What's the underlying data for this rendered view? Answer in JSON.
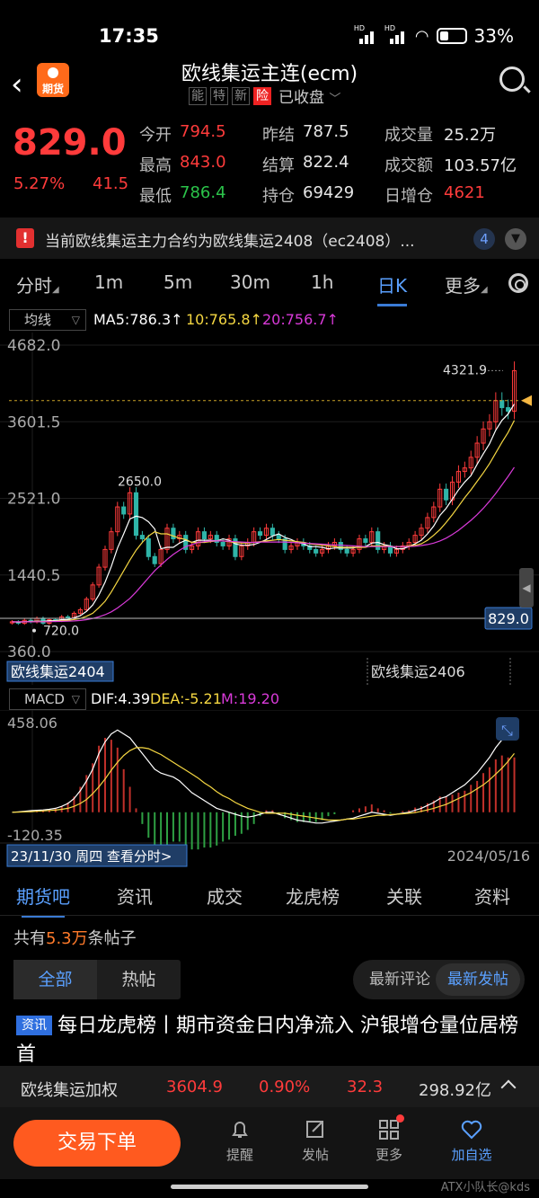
{
  "status": {
    "time": "17:35",
    "hd1": "HD",
    "hd2": "HD",
    "battery": "33%"
  },
  "header": {
    "logo_text": "期货",
    "title": "欧线集运主连(ecm)",
    "tags": [
      "能",
      "特",
      "新",
      "险"
    ],
    "state": "已收盘"
  },
  "quote": {
    "price": "829.0",
    "pct": "5.27%",
    "change": "41.5",
    "fields": [
      {
        "k": "今开",
        "v": "794.5",
        "color": "red"
      },
      {
        "k": "昨结",
        "v": "787.5",
        "color": "white"
      },
      {
        "k": "成交量",
        "v": "25.2万",
        "color": "white"
      },
      {
        "k": "最高",
        "v": "843.0",
        "color": "red"
      },
      {
        "k": "结算",
        "v": "822.4",
        "color": "white"
      },
      {
        "k": "成交额",
        "v": "103.57亿",
        "color": "white"
      },
      {
        "k": "最低",
        "v": "786.4",
        "color": "green"
      },
      {
        "k": "持仓",
        "v": "69429",
        "color": "white"
      },
      {
        "k": "日增仓",
        "v": "4621",
        "color": "red"
      }
    ]
  },
  "notice": {
    "text": "当前欧线集运主力合约为欧线集运2408（ec2408）...",
    "count": "4"
  },
  "periods": {
    "items": [
      "分时",
      "1m",
      "5m",
      "30m",
      "1h",
      "日K",
      "更多"
    ],
    "active": "日K"
  },
  "ma": {
    "selector": "均线",
    "ma5": "MA5:786.3↑",
    "ma10": "10:765.8↑",
    "ma20": "20:756.7↑"
  },
  "colors": {
    "up": "#ff3b3b",
    "down": "#2bc34a",
    "ma5": "#ffffff",
    "ma10": "#f5d742",
    "ma20": "#d93ad9",
    "accent": "#3a7bd5",
    "orange": "#ff5a1f"
  },
  "chart_data": [
    {
      "type": "candlestick",
      "title": "",
      "y_labels": [
        "4682.0",
        "3601.5",
        "2521.0",
        "1440.5",
        "360.0"
      ],
      "ylim": [
        360.0,
        4682.0
      ],
      "high_marker": "4321.9",
      "low_marker": "720.0",
      "peak_marker": "2650.0",
      "last_price_label": "829.0",
      "contract_labels": [
        "欧线集运2404",
        "欧线集运2406"
      ],
      "closes": [
        780,
        760,
        800,
        780,
        830,
        760,
        810,
        800,
        850,
        830,
        900,
        950,
        1100,
        1300,
        1550,
        1800,
        2050,
        2400,
        2300,
        2600,
        2000,
        1950,
        1700,
        1600,
        1800,
        2100,
        1950,
        2000,
        1800,
        1850,
        2050,
        1950,
        2000,
        1900,
        1850,
        1950,
        1700,
        1850,
        1900,
        2050,
        2000,
        2100,
        2000,
        1950,
        1800,
        1850,
        1900,
        1850,
        1800,
        1750,
        1800,
        1850,
        1900,
        1800,
        1750,
        1800,
        1950,
        1900,
        2050,
        1800,
        1850,
        1750,
        1800,
        1850,
        1900,
        2000,
        2100,
        2250,
        2400,
        2650,
        2500,
        2750,
        2900,
        2950,
        3100,
        3300,
        3500,
        3600,
        3900,
        3800,
        3750,
        4321.9
      ],
      "ma5": [
        780,
        775,
        780,
        784,
        790,
        786,
        796,
        796,
        810,
        810,
        838,
        866,
        926,
        1016,
        1160,
        1340,
        1560,
        1820,
        2020,
        2230,
        2270,
        2250,
        2190,
        2090,
        1810,
        1830,
        1830,
        1890,
        1930,
        1900,
        1930,
        1930,
        1930,
        1920,
        1950,
        1930,
        1880,
        1860,
        1860,
        1870,
        1900,
        1940,
        1990,
        2020,
        1970,
        1940,
        1900,
        1880,
        1840,
        1840,
        1830,
        1810,
        1820,
        1820,
        1820,
        1820,
        1840,
        1840,
        1890,
        1900,
        1870,
        1850,
        1810,
        1810,
        1840,
        1880,
        1930,
        2020,
        2130,
        2280,
        2380,
        2510,
        2640,
        2750,
        2840,
        3000,
        3150,
        3290,
        3480,
        3620,
        3710,
        3850
      ],
      "ma10": [
        780,
        778,
        779,
        780,
        785,
        782,
        785,
        788,
        795,
        800,
        812,
        826,
        858,
        900,
        980,
        1070,
        1200,
        1350,
        1500,
        1650,
        1790,
        1900,
        1990,
        2050,
        2020,
        2020,
        1990,
        1960,
        1940,
        1900,
        1900,
        1900,
        1910,
        1920,
        1920,
        1910,
        1900,
        1890,
        1890,
        1900,
        1910,
        1920,
        1930,
        1940,
        1930,
        1920,
        1910,
        1900,
        1880,
        1870,
        1860,
        1850,
        1840,
        1830,
        1830,
        1830,
        1830,
        1830,
        1850,
        1850,
        1850,
        1840,
        1840,
        1840,
        1850,
        1860,
        1880,
        1930,
        2000,
        2080,
        2180,
        2290,
        2410,
        2530,
        2640,
        2760,
        2880,
        3010,
        3160,
        3310,
        3450,
        3620
      ],
      "ma20": [
        780,
        779,
        779,
        780,
        781,
        781,
        782,
        784,
        786,
        788,
        792,
        798,
        810,
        826,
        850,
        880,
        920,
        975,
        1040,
        1110,
        1200,
        1300,
        1400,
        1500,
        1580,
        1660,
        1730,
        1790,
        1840,
        1870,
        1900,
        1910,
        1920,
        1920,
        1920,
        1915,
        1910,
        1905,
        1900,
        1900,
        1905,
        1905,
        1905,
        1905,
        1905,
        1900,
        1895,
        1890,
        1885,
        1880,
        1875,
        1870,
        1865,
        1860,
        1855,
        1850,
        1845,
        1840,
        1840,
        1840,
        1840,
        1840,
        1840,
        1840,
        1840,
        1845,
        1855,
        1870,
        1890,
        1920,
        1960,
        2010,
        2070,
        2140,
        2210,
        2290,
        2380,
        2480,
        2590,
        2710,
        2830,
        2960
      ]
    },
    {
      "type": "macd",
      "title": "",
      "indicator": "MACD",
      "dif_label": "DIF:4.39",
      "dea_label": "DEA:-5.21",
      "m_label": "M:19.20",
      "y_labels": [
        "458.06",
        "-120.35"
      ],
      "ylim": [
        -120.35,
        458.06
      ],
      "date_start": "23/11/30 周四 查看分时>",
      "date_end": "2024/05/16",
      "dif": [
        0,
        2,
        5,
        8,
        10,
        12,
        15,
        20,
        30,
        45,
        70,
        110,
        160,
        220,
        300,
        360,
        400,
        420,
        400,
        380,
        340,
        300,
        260,
        220,
        200,
        190,
        180,
        160,
        130,
        100,
        80,
        60,
        40,
        20,
        10,
        0,
        -10,
        -20,
        -25,
        -20,
        -10,
        0,
        0,
        -10,
        -20,
        -30,
        -40,
        -45,
        -50,
        -55,
        -55,
        -50,
        -45,
        -40,
        -35,
        -30,
        -20,
        -10,
        0,
        -5,
        -10,
        -15,
        -10,
        -5,
        0,
        10,
        20,
        35,
        50,
        70,
        80,
        100,
        120,
        140,
        170,
        200,
        240,
        280,
        330,
        370,
        400,
        440
      ],
      "dea": [
        0,
        1,
        2,
        3,
        5,
        7,
        9,
        11,
        15,
        20,
        30,
        45,
        65,
        95,
        130,
        170,
        215,
        255,
        290,
        315,
        330,
        330,
        325,
        310,
        295,
        275,
        255,
        235,
        215,
        195,
        175,
        150,
        130,
        105,
        85,
        70,
        50,
        35,
        20,
        10,
        0,
        -5,
        -5,
        -5,
        -5,
        -10,
        -15,
        -20,
        -25,
        -30,
        -35,
        -40,
        -40,
        -40,
        -35,
        -35,
        -30,
        -25,
        -20,
        -15,
        -15,
        -12,
        -10,
        -8,
        -5,
        -2,
        5,
        12,
        20,
        30,
        40,
        55,
        70,
        85,
        100,
        120,
        140,
        165,
        195,
        225,
        260,
        300
      ],
      "hist": [
        0,
        2,
        6,
        10,
        10,
        10,
        12,
        18,
        30,
        50,
        80,
        130,
        190,
        250,
        340,
        380,
        370,
        330,
        220,
        130,
        20,
        -60,
        -130,
        -180,
        -190,
        -170,
        -150,
        -150,
        -170,
        -190,
        -190,
        -180,
        -180,
        -170,
        -150,
        -140,
        -120,
        -110,
        -90,
        -60,
        -20,
        10,
        10,
        -10,
        -30,
        -40,
        -50,
        -50,
        -50,
        -50,
        -40,
        -20,
        -10,
        0,
        0,
        10,
        20,
        30,
        40,
        20,
        10,
        -5,
        0,
        6,
        10,
        24,
        30,
        46,
        60,
        80,
        80,
        90,
        100,
        110,
        140,
        160,
        200,
        230,
        270,
        290,
        280,
        280
      ]
    }
  ],
  "subtabs": {
    "items": [
      "期货吧",
      "资讯",
      "成交",
      "龙虎榜",
      "关联",
      "资料"
    ],
    "active": "期货吧"
  },
  "forum": {
    "posts_prefix": "共有",
    "posts_num": "5.3万",
    "posts_suffix": "条帖子",
    "filter_all": "全部",
    "filter_hot": "热帖",
    "sort_comment": "最新评论",
    "sort_post": "最新发帖",
    "article_badge": "资讯",
    "article_title": "每日龙虎榜丨期市资金日内净流入 沪银增仓量位居榜首"
  },
  "ticker": {
    "name": "欧线集运加权",
    "price": "3604.9",
    "pct": "0.90%",
    "chg": "32.3",
    "amount": "298.92亿"
  },
  "bottom": {
    "trade": "交易下单",
    "nav": [
      "提醒",
      "发帖",
      "更多",
      "加自选"
    ]
  },
  "watermark": "ATX小队长@kds"
}
